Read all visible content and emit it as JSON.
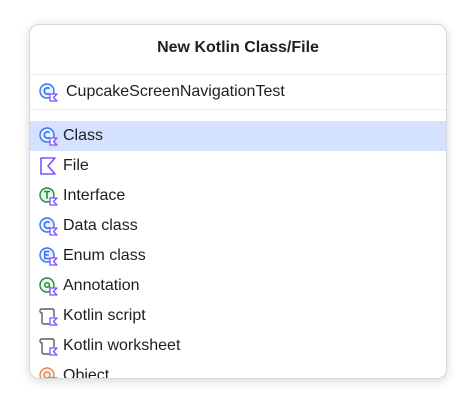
{
  "dialog": {
    "title": "New Kotlin Class/File",
    "name_input": {
      "value": "CupcakeScreenNavigationTest",
      "icon": "kotlin-class-icon"
    },
    "items": [
      {
        "label": "Class",
        "icon": "kotlin-class-icon",
        "selected": true
      },
      {
        "label": "File",
        "icon": "kotlin-file-icon",
        "selected": false
      },
      {
        "label": "Interface",
        "icon": "kotlin-interface-icon",
        "selected": false
      },
      {
        "label": "Data class",
        "icon": "kotlin-data-class-icon",
        "selected": false
      },
      {
        "label": "Enum class",
        "icon": "kotlin-enum-class-icon",
        "selected": false
      },
      {
        "label": "Annotation",
        "icon": "kotlin-annotation-icon",
        "selected": false
      },
      {
        "label": "Kotlin script",
        "icon": "kotlin-script-icon",
        "selected": false
      },
      {
        "label": "Kotlin worksheet",
        "icon": "kotlin-worksheet-icon",
        "selected": false
      },
      {
        "label": "Object",
        "icon": "kotlin-object-icon",
        "selected": false
      }
    ]
  },
  "colors": {
    "selection": "#d4e2ff",
    "class_blue": "#3574f0",
    "interface_green": "#208a3c",
    "object_orange": "#e08855",
    "kotlin_purple": "#7f52ff"
  }
}
